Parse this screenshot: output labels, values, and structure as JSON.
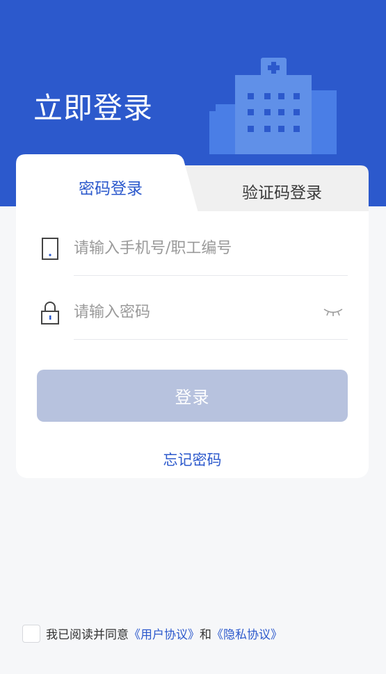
{
  "header": {
    "title": "立即登录"
  },
  "tabs": [
    {
      "label": "密码登录",
      "active": true
    },
    {
      "label": "验证码登录",
      "active": false
    }
  ],
  "form": {
    "phone_placeholder": "请输入手机号/职工编号",
    "phone_value": "",
    "password_placeholder": "请输入密码",
    "password_value": "",
    "login_label": "登录",
    "forgot_label": "忘记密码"
  },
  "agreement": {
    "prefix": "我已阅读并同意",
    "user_agreement": "《用户协议》",
    "conjunction": "和",
    "privacy_agreement": "《隐私协议》",
    "checked": false
  },
  "colors": {
    "primary": "#2c59cc",
    "button_disabled": "#b7c2de",
    "background": "#f6f7f9"
  },
  "icons": [
    "hospital-building-icon",
    "phone-icon",
    "lock-icon",
    "eye-closed-icon"
  ]
}
